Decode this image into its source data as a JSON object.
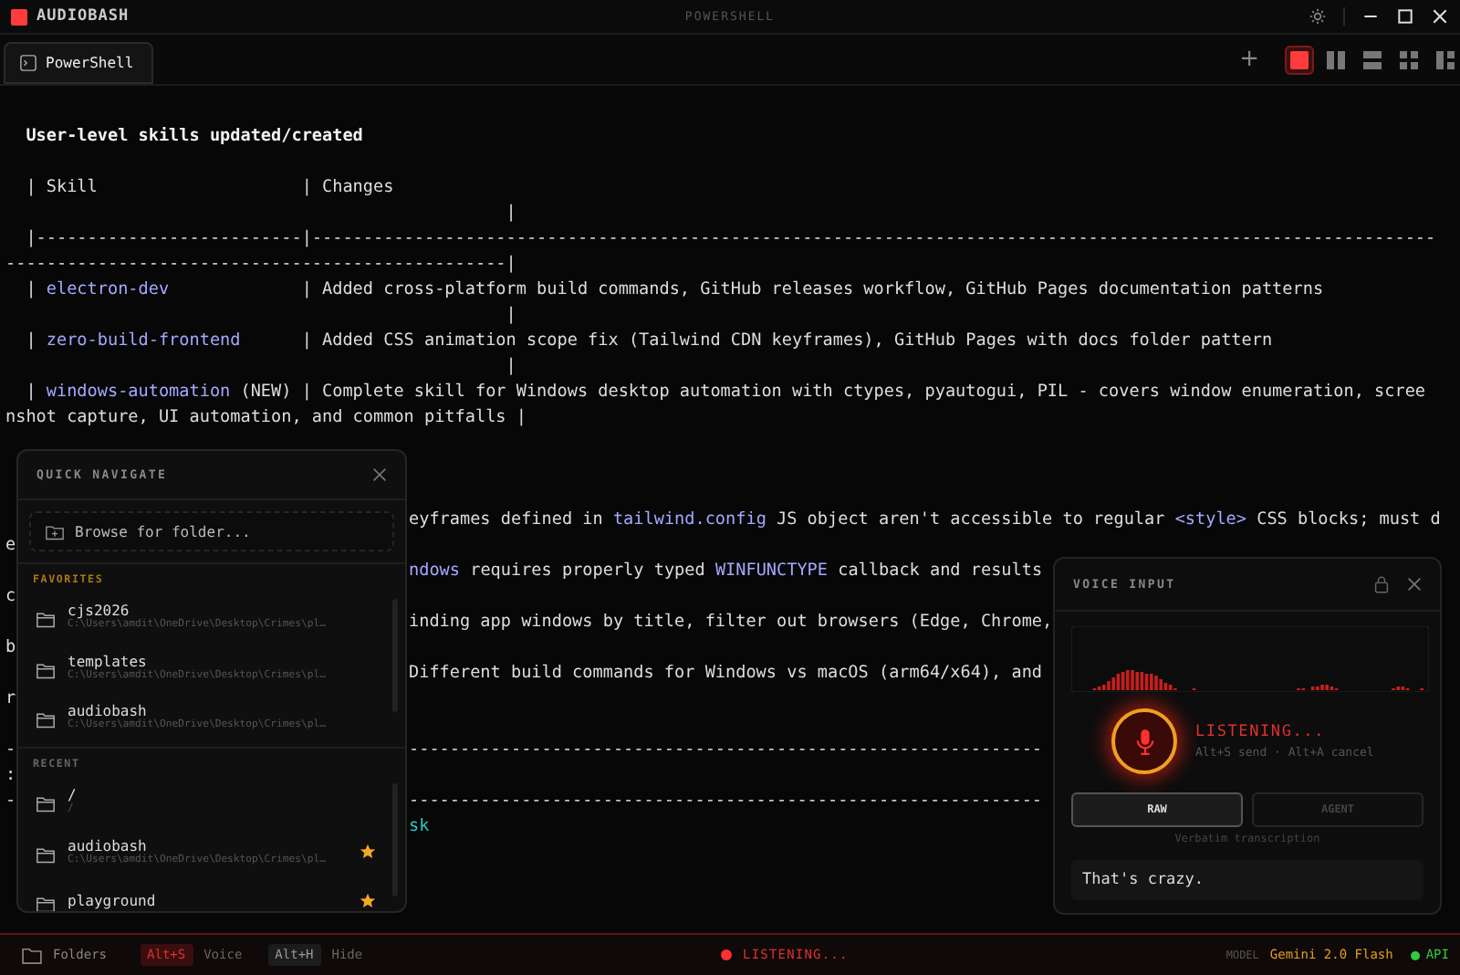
{
  "app": {
    "name": "AUDIOBASH",
    "title": "POWERSHELL"
  },
  "tabs": [
    {
      "label": "PowerShell",
      "selected": true
    }
  ],
  "new_tab": "+",
  "layouts": [
    {
      "kind": "single",
      "selected": true
    },
    {
      "kind": "columns",
      "selected": false
    },
    {
      "kind": "rows",
      "selected": false
    },
    {
      "kind": "grid",
      "selected": false
    },
    {
      "kind": "sidebar",
      "selected": false
    }
  ],
  "terminal": [
    {
      "kind": "line",
      "parts": [
        {
          "kind": "heading",
          "text": "  User-level skills updated/created"
        }
      ]
    },
    {
      "kind": "blank"
    },
    {
      "kind": "line",
      "parts": [
        {
          "kind": "text",
          "text": "  | Skill                    | Changes"
        }
      ]
    },
    {
      "kind": "line",
      "parts": [
        {
          "kind": "text",
          "text": "                                                 |"
        }
      ]
    },
    {
      "kind": "line",
      "parts": [
        {
          "kind": "text",
          "text": "  |--------------------------|--------------------------------------------------------------------------------------------------------------"
        }
      ]
    },
    {
      "kind": "line",
      "parts": [
        {
          "kind": "text",
          "text": "-------------------------------------------------|"
        }
      ]
    },
    {
      "kind": "line",
      "parts": [
        {
          "kind": "text",
          "text": "  | "
        },
        {
          "kind": "code",
          "text": "electron-dev"
        },
        {
          "kind": "text",
          "text": "             | Added cross-platform build commands, GitHub releases workflow, GitHub Pages documentation patterns"
        }
      ]
    },
    {
      "kind": "line",
      "parts": [
        {
          "kind": "text",
          "text": "                                                 |"
        }
      ]
    },
    {
      "kind": "line",
      "parts": [
        {
          "kind": "text",
          "text": "  | "
        },
        {
          "kind": "code",
          "text": "zero-build-frontend"
        },
        {
          "kind": "text",
          "text": "      | Added CSS animation scope fix (Tailwind CDN keyframes), GitHub Pages with docs folder pattern"
        }
      ]
    },
    {
      "kind": "line",
      "parts": [
        {
          "kind": "text",
          "text": "                                                 |"
        }
      ]
    },
    {
      "kind": "line",
      "parts": [
        {
          "kind": "text",
          "text": "  | "
        },
        {
          "kind": "code",
          "text": "windows-automation"
        },
        {
          "kind": "text",
          "text": " (NEW) | Complete skill for Windows desktop automation with ctypes, pyautogui, PIL - covers window enumeration, scree"
        }
      ]
    },
    {
      "kind": "line",
      "parts": [
        {
          "kind": "text",
          "text": "nshot capture, UI automation, and common pitfalls |"
        }
      ]
    },
    {
      "kind": "blank"
    },
    {
      "kind": "blank"
    },
    {
      "kind": "blank"
    },
    {
      "kind": "split",
      "parts": [
        {
          "kind": "text",
          "text": "eyframes defined in "
        },
        {
          "kind": "code",
          "text": "tailwind.config"
        },
        {
          "kind": "text",
          "text": " JS object aren't accessible to regular "
        },
        {
          "kind": "code",
          "text": "<style>"
        },
        {
          "kind": "text",
          "text": " CSS blocks; must d"
        }
      ]
    },
    {
      "kind": "split",
      "edge": "e"
    },
    {
      "kind": "split",
      "parts": [
        {
          "kind": "code",
          "text": "ndows"
        },
        {
          "kind": "text",
          "text": " requires properly typed "
        },
        {
          "kind": "code",
          "text": "WINFUNCTYPE"
        },
        {
          "kind": "text",
          "text": " callback and results"
        }
      ]
    },
    {
      "kind": "split",
      "edge": "c"
    },
    {
      "kind": "split",
      "parts": [
        {
          "kind": "text",
          "text": "inding app windows by title, filter out browsers (Edge, Chrome,"
        }
      ]
    },
    {
      "kind": "split",
      "edge": "b"
    },
    {
      "kind": "split",
      "parts": [
        {
          "kind": "text",
          "text": "Different build commands for Windows vs macOS (arm64/x64), and"
        }
      ]
    },
    {
      "kind": "split",
      "edge": "r"
    },
    {
      "kind": "blank"
    },
    {
      "kind": "split",
      "edge": "-",
      "parts": [
        {
          "kind": "text",
          "text": "--------------------------------------------------------------"
        }
      ]
    },
    {
      "kind": "split",
      "edge": ":"
    },
    {
      "kind": "split",
      "edge": "-",
      "parts": [
        {
          "kind": "text",
          "text": "--------------------------------------------------------------"
        }
      ]
    },
    {
      "kind": "split",
      "parts": [
        {
          "kind": "accent",
          "text": "sk"
        }
      ]
    }
  ],
  "quick_navigate": {
    "title": "QUICK NAVIGATE",
    "browse": "Browse for folder...",
    "sections": [
      {
        "label": "FAVORITES",
        "kind": "favorites",
        "items": [
          {
            "name": "cjs2026",
            "path": "C:\\Users\\amdit\\OneDrive\\Desktop\\Crimes\\pl…",
            "starred": false
          },
          {
            "name": "templates",
            "path": "C:\\Users\\amdit\\OneDrive\\Desktop\\Crimes\\pl…",
            "starred": false
          },
          {
            "name": "audiobash",
            "path": "C:\\Users\\amdit\\OneDrive\\Desktop\\Crimes\\pl…",
            "starred": false
          }
        ]
      },
      {
        "label": "RECENT",
        "kind": "recent",
        "items": [
          {
            "name": "/",
            "path": "/",
            "starred": false
          },
          {
            "name": "audiobash",
            "path": "C:\\Users\\amdit\\OneDrive\\Desktop\\Crimes\\pl…",
            "starred": true
          },
          {
            "name": "playground",
            "starred": true
          }
        ]
      }
    ]
  },
  "voice_input": {
    "title": "VOICE INPUT",
    "status": "LISTENING...",
    "hint": "Alt+S send · Alt+A cancel",
    "modes": [
      {
        "label": "RAW",
        "selected": true
      },
      {
        "label": "AGENT",
        "selected": false
      }
    ],
    "mode_description": "Verbatim transcription",
    "transcript": "That's crazy."
  },
  "status_bar": {
    "folders": "Folders",
    "shortcuts": [
      {
        "key": "Alt+S",
        "label": "Voice",
        "active": true
      },
      {
        "key": "Alt+H",
        "label": "Hide",
        "active": false
      }
    ],
    "status": "LISTENING...",
    "model_label": "MODEL",
    "model": "Gemini 2.0 Flash",
    "api": "API"
  }
}
